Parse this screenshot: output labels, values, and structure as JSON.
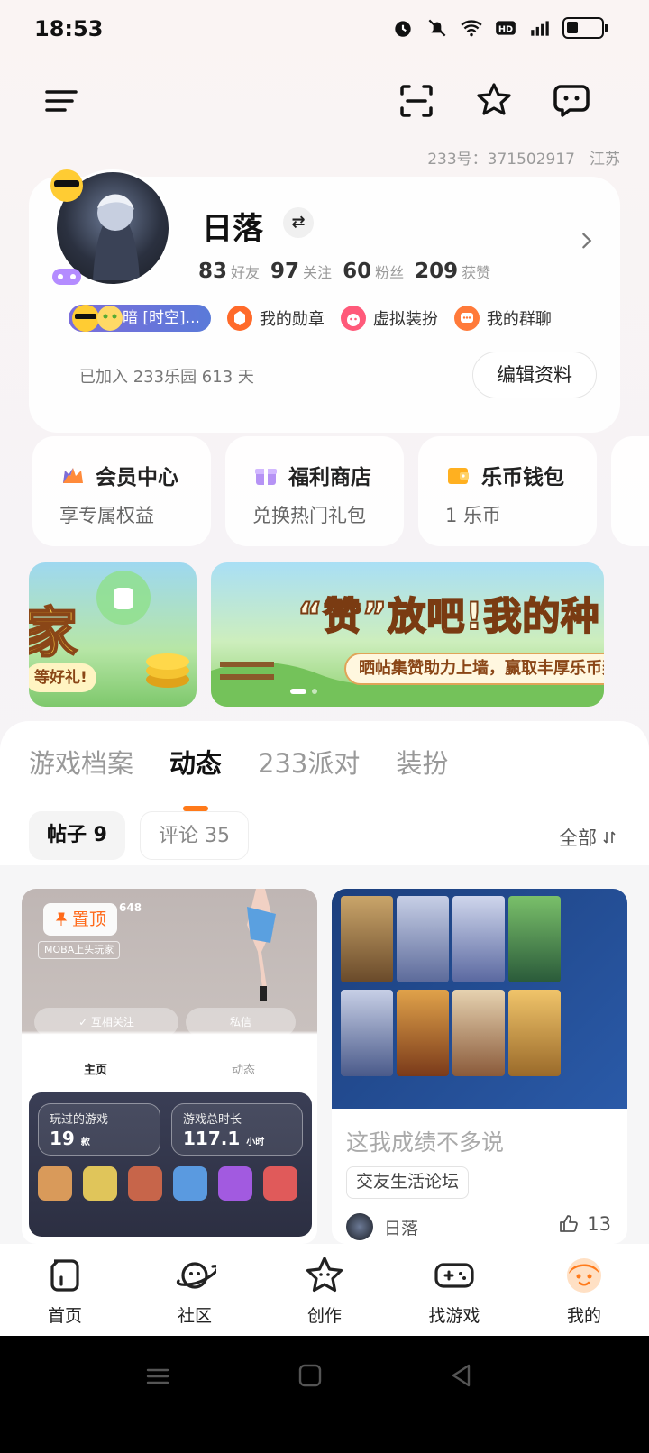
{
  "status_bar": {
    "time": "18:53"
  },
  "account": {
    "id_label": "233号：371502917",
    "region": "江苏"
  },
  "profile": {
    "name": "日落",
    "switch_symbol": "⇄",
    "stats": [
      {
        "num": "83",
        "label": "好友"
      },
      {
        "num": "97",
        "label": "关注"
      },
      {
        "num": "60",
        "label": "粉丝"
      },
      {
        "num": "209",
        "label": "获赞"
      }
    ],
    "title_pill": "暗 [时空]...",
    "badges": [
      {
        "label": "我的勋章"
      },
      {
        "label": "虚拟装扮"
      },
      {
        "label": "我的群聊"
      }
    ],
    "joined": "已加入 233乐园 613 天",
    "edit_label": "编辑资料"
  },
  "quick_cards": [
    {
      "title": "会员中心",
      "subtitle": "享专属权益"
    },
    {
      "title": "福利商店",
      "subtitle": "兑换热门礼包"
    },
    {
      "title": "乐币钱包",
      "subtitle": "1 乐币"
    }
  ],
  "banner": {
    "left_text_1": "家",
    "left_text_2": "等好礼!",
    "title": "“赞”放吧!我的种",
    "subtitle": "晒帖集赞助力上墙，赢取丰厚乐币奖"
  },
  "tabs": [
    "游戏档案",
    "动态",
    "233派对",
    "装扮"
  ],
  "subtabs": [
    "帖子 9",
    "评论 35"
  ],
  "filter_label": "全部",
  "posts": [
    {
      "pin_label": "置顶",
      "inner_text_1": "玩过的游戏",
      "inner_value_1": "19",
      "inner_unit_1": "款",
      "inner_text_2": "游戏总时长",
      "inner_value_2": "117.1",
      "inner_unit_2": "小时",
      "tab_home": "主页",
      "tab_feed": "动态",
      "btn_mutual": "✓ 互相关注",
      "btn_msg": "私信",
      "tag_moba": "MOBA上头玩家",
      "likes_fragment": "648"
    },
    {
      "title": "这我成绩不多说",
      "tag": "交友生活论坛",
      "author": "日落",
      "likes": "13"
    }
  ],
  "bottom_nav": [
    "首页",
    "社区",
    "创作",
    "找游戏",
    "我的"
  ],
  "colors": {
    "accent": "#ff7a1a",
    "title_pill": "#6a74db"
  }
}
